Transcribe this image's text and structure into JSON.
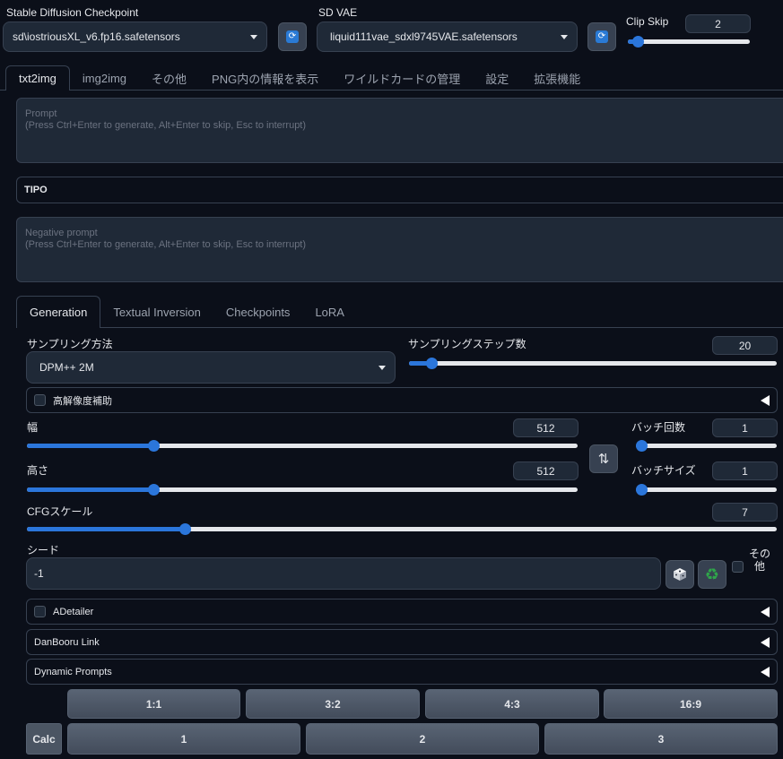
{
  "top": {
    "checkpoint_label": "Stable Diffusion Checkpoint",
    "checkpoint_value": "sd\\iostriousXL_v6.fp16.safetensors",
    "vae_label": "SD VAE",
    "vae_value": "liquid111vae_sdxl9745VAE.safetensors",
    "clip_skip_label": "Clip Skip",
    "clip_skip_value": "2",
    "clip_skip_level": 0.08
  },
  "main_tabs": [
    "txt2img",
    "img2img",
    "その他",
    "PNG内の情報を表示",
    "ワイルドカードの管理",
    "設定",
    "拡張機能"
  ],
  "prompt": {
    "placeholder_line1": "Prompt",
    "placeholder_line2": "(Press Ctrl+Enter to generate, Alt+Enter to skip, Esc to interrupt)"
  },
  "tipo_label": "TIPO",
  "negative_prompt": {
    "placeholder_line1": "Negative prompt",
    "placeholder_line2": "(Press Ctrl+Enter to generate, Alt+Enter to skip, Esc to interrupt)"
  },
  "sub_tabs": [
    "Generation",
    "Textual Inversion",
    "Checkpoints",
    "LoRA"
  ],
  "generation": {
    "sampler_label": "サンプリング方法",
    "sampler_value": "DPM++ 2M",
    "steps_label": "サンプリングステップ数",
    "steps_value": "20",
    "steps_level": 0.061,
    "hires_label": "高解像度補助",
    "width_label": "幅",
    "width_value": "512",
    "width_level": 0.23,
    "height_label": "高さ",
    "height_value": "512",
    "height_level": 0.23,
    "swap_glyph": "⇅",
    "batch_count_label": "バッチ回数",
    "batch_count_value": "1",
    "batch_count_level": 0.0,
    "batch_size_label": "バッチサイズ",
    "batch_size_value": "1",
    "batch_size_level": 0.0,
    "cfg_label": "CFGスケール",
    "cfg_value": "7",
    "cfg_level": 0.21,
    "seed_label": "シード",
    "seed_value": "-1",
    "extra_line1": "その",
    "extra_line2": "他"
  },
  "accordions": {
    "adetailer": "ADetailer",
    "danbooru": "DanBooru Link",
    "dynamic": "Dynamic Prompts"
  },
  "ratio_buttons": [
    "1:1",
    "3:2",
    "4:3",
    "16:9"
  ],
  "calc_label": "Calc",
  "number_buttons": [
    "1",
    "2",
    "3"
  ],
  "icons": {
    "refresh": "refresh-icon",
    "dice": "dice-icon",
    "recycle": "recycle-icon",
    "swap": "swap-icon"
  },
  "colors": {
    "accent": "#2b76db",
    "recycle": "#2fa54a"
  }
}
